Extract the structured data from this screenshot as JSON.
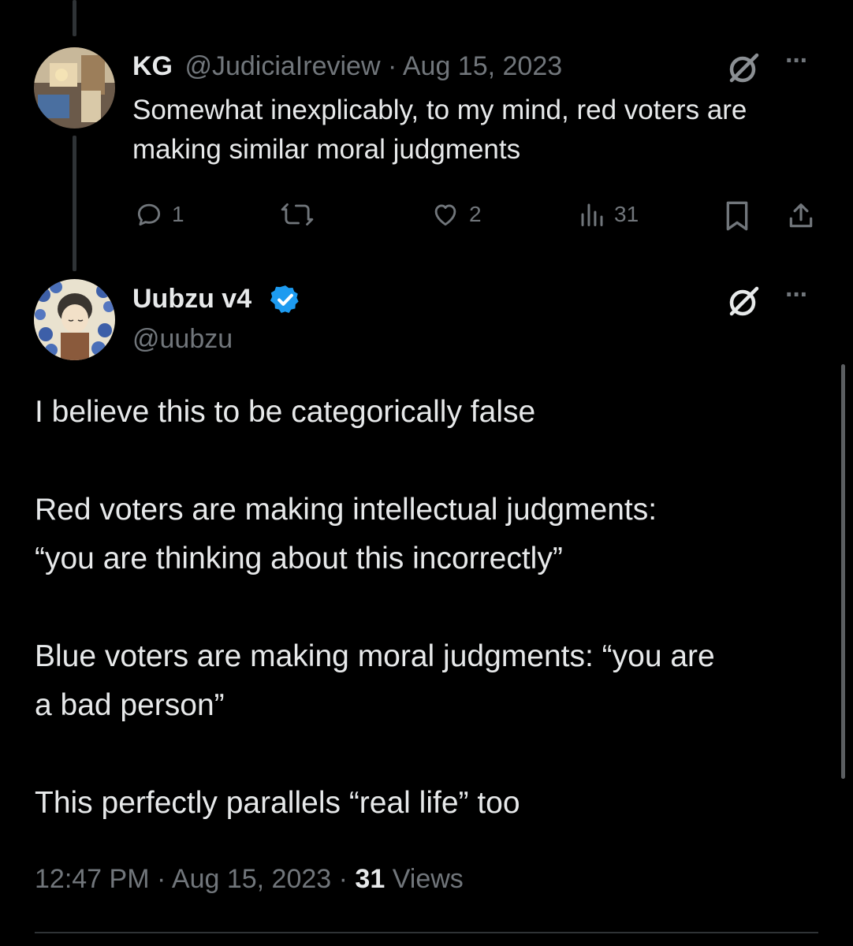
{
  "parent_tweet": {
    "author_name": "KG",
    "handle": "@JudiciaIreview",
    "separator": "·",
    "date": "Aug 15, 2023",
    "text_line1": "Somewhat inexplicably, to my mind, red voters are",
    "text_line2": "making similar moral judgments",
    "actions": {
      "replies": "1",
      "retweets": "",
      "likes": "2",
      "views": "31"
    },
    "more_label": "···"
  },
  "main_tweet": {
    "author_name": "Uubzu v4",
    "verified": true,
    "handle": "@uubzu",
    "more_label": "···",
    "paragraphs": [
      "I believe this to be categorically false",
      "Red voters are making intellectual judgments:",
      "“you are thinking about this incorrectly”",
      "Blue voters are making moral judgments: “you are",
      "a bad person”",
      "This perfectly parallels “real life” too"
    ],
    "time": "12:47 PM",
    "date": "Aug 15, 2023",
    "separator": "·",
    "views_count": "31",
    "views_label": "Views"
  },
  "colors": {
    "background": "#000000",
    "text": "#e7e9ea",
    "muted": "#71767b",
    "verified": "#1d9bf0"
  }
}
